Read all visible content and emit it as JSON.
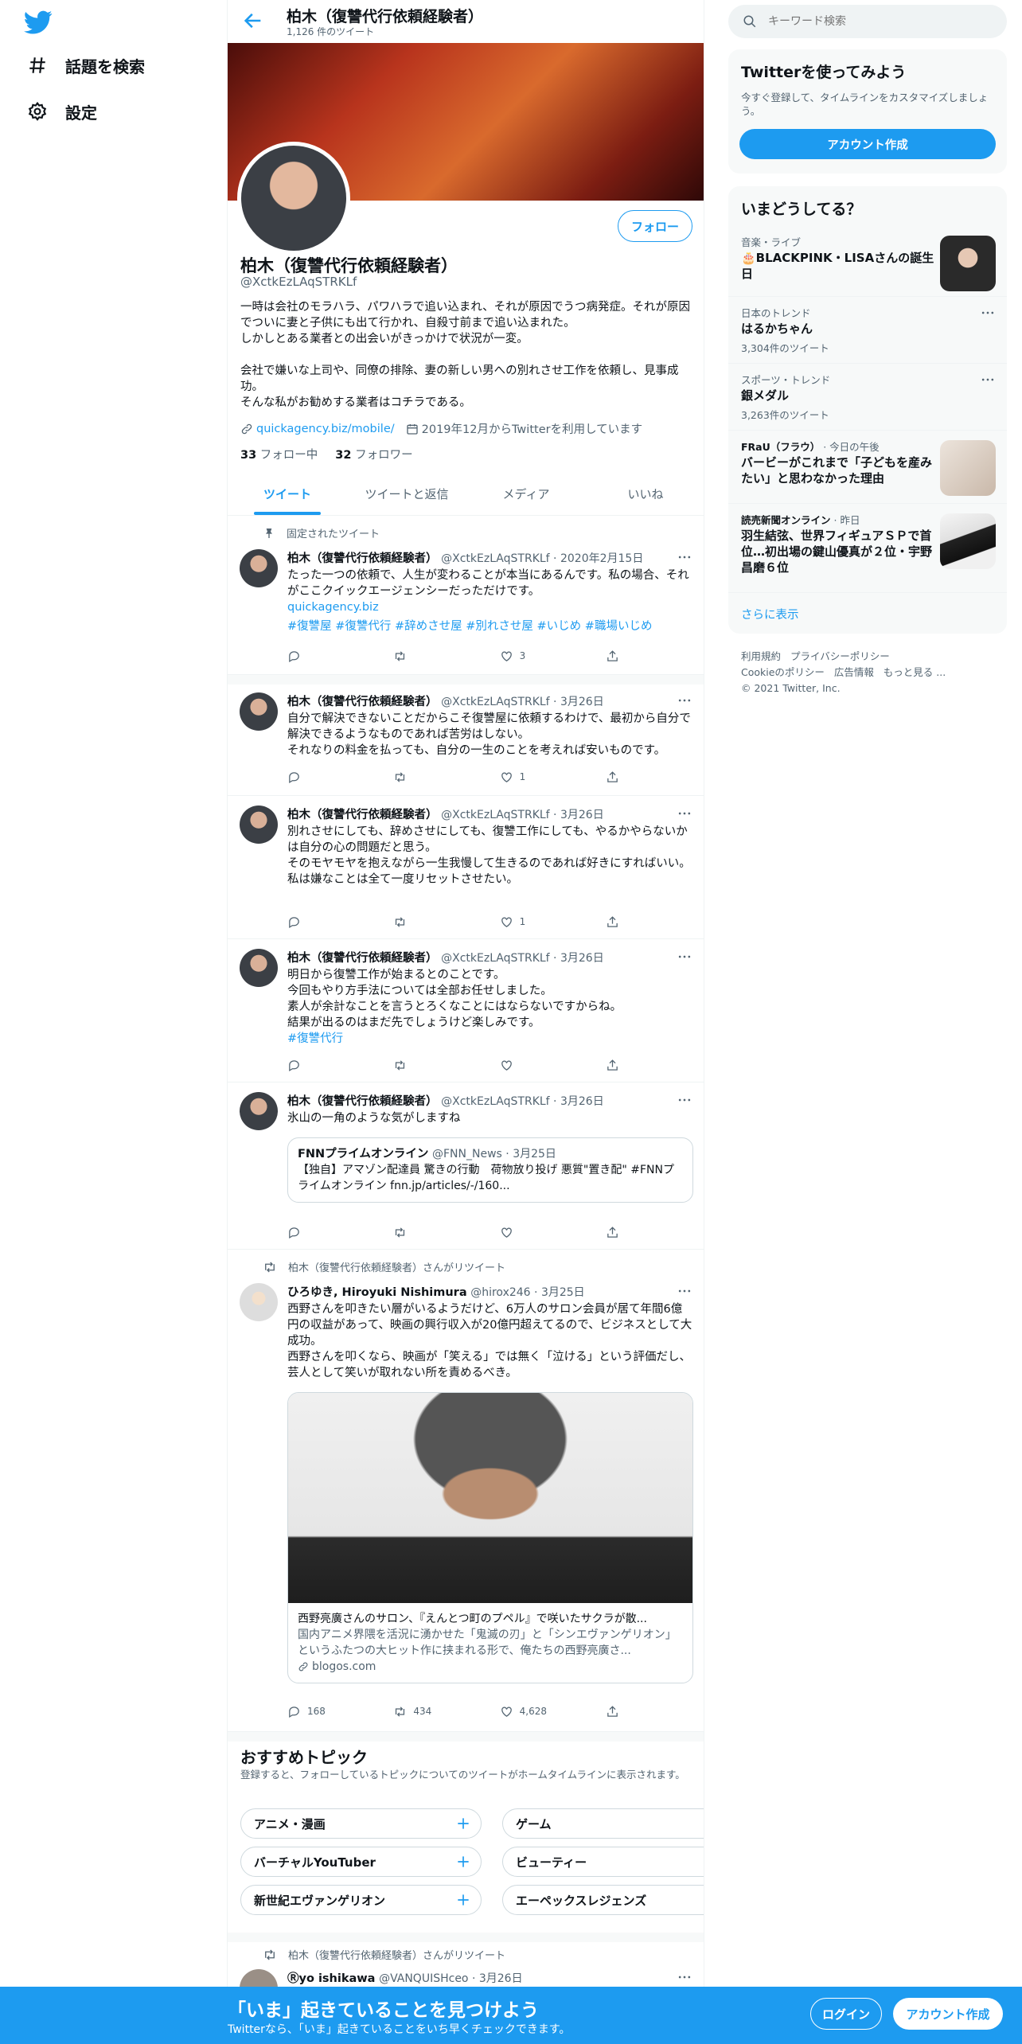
{
  "nav": {
    "explore": "話題を検索",
    "settings": "設定"
  },
  "header": {
    "title": "柏木（復讐代行依頼経験者）",
    "tweet_count": "1,126 件のツイート"
  },
  "profile": {
    "name": "柏木（復讐代行依頼経験者）",
    "handle": "@XctkEzLAqSTRKLf",
    "follow_label": "フォロー",
    "bio": [
      "一時は会社のモラハラ、パワハラで追い込まれ、それが原因でうつ病発症。それが原因でついに妻と子供にも出て行かれ、自殺寸前まで追い込まれた。",
      "しかしとある業者との出会いがきっかけで状況が一変。",
      "",
      "会社で嫌いな上司や、同僚の排除、妻の新しい男への別れさせ工作を依頼し、見事成功。",
      "そんな私がお勧めする業者はコチラである。"
    ],
    "link": "quickagency.biz/mobile/",
    "joined": "2019年12月からTwitterを利用しています",
    "following_count": "33",
    "following_label": "フォロー中",
    "followers_count": "32",
    "followers_label": "フォロワー"
  },
  "tabs": [
    "ツイート",
    "ツイートと返信",
    "メディア",
    "いいね"
  ],
  "tweets": [
    {
      "label": "固定されたツイート",
      "name": "柏木（復讐代行依頼経験者）",
      "handle": "@XctkEzLAqSTRKLf",
      "date": "2020年2月15日",
      "text": [
        "たった一つの依頼で、人生が変わることが本当にあるんです。私の場合、それがここクイックエージェンシーだっただけです。"
      ],
      "link": "quickagency.biz",
      "hashtags": "#復讐屋 #復讐代行 #辞めさせ屋 #別れさせ屋 #いじめ #職場いじめ",
      "likes": "3"
    },
    {
      "name": "柏木（復讐代行依頼経験者）",
      "handle": "@XctkEzLAqSTRKLf",
      "date": "3月26日",
      "text": [
        "自分で解決できないことだからこそ復讐屋に依頼するわけで、最初から自分で解決できるようなものであれば苦労はしない。",
        "それなりの料金を払っても、自分の一生のことを考えれば安いものです。"
      ],
      "likes": "1"
    },
    {
      "name": "柏木（復讐代行依頼経験者）",
      "handle": "@XctkEzLAqSTRKLf",
      "date": "3月26日",
      "text": [
        "別れさせにしても、辞めさせにしても、復讐工作にしても、やるかやらないかは自分の心の問題だと思う。",
        "そのモヤモヤを抱えながら一生我慢して生きるのであれば好きにすればいい。",
        "私は嫌なことは全て一度リセットさせたい。"
      ],
      "likes": "1"
    },
    {
      "name": "柏木（復讐代行依頼経験者）",
      "handle": "@XctkEzLAqSTRKLf",
      "date": "3月26日",
      "text": [
        "明日から復讐工作が始まるとのことです。",
        "今回もやり方手法については全部お任せしました。",
        "素人が余計なことを言うとろくなことにはならないですからね。",
        "結果が出るのはまだ先でしょうけど楽しみです。"
      ],
      "hashtags": "#復讐代行"
    },
    {
      "name": "柏木（復讐代行依頼経験者）",
      "handle": "@XctkEzLAqSTRKLf",
      "date": "3月26日",
      "text": [
        "氷山の一角のような気がしますね"
      ],
      "quote": {
        "name": "FNNプライムオンライン",
        "handle": "@FNN_News",
        "date": "3月25日",
        "text": "【独自】アマゾン配達員 驚きの行動　荷物放り投げ 悪質\"置き配\" #FNNプライムオンライン fnn.jp/articles/-/160..."
      }
    },
    {
      "label": "柏木（復讐代行依頼経験者）さんがリツイート",
      "name": "ひろゆき, Hiroyuki Nishimura",
      "handle": "@hirox246",
      "date": "3月25日",
      "text": [
        "西野さんを叩きたい層がいるようだけど、6万人のサロン会員が居て年間6億円の収益があって、映画の興行収入が20億円超えてるので、ビジネスとして大成功。",
        "西野さんを叩くなら、映画が「笑える」では無く「泣ける」という評価だし、芸人として笑いが取れない所を責めるべき。"
      ],
      "card": {
        "title": "西野亮廣さんのサロン、『えんとつ町のプペル』で咲いたサクラが散...",
        "desc": "国内アニメ界隈を活況に湧かせた「鬼滅の刃」と「シンエヴァンゲリオン」というふたつの大ヒット作に挟まれる形で、俺たちの西野亮廣さ...",
        "domain": "blogos.com"
      },
      "replies": "168",
      "retweets": "434",
      "likes": "4,628"
    }
  ],
  "topics": {
    "title": "おすすめトピック",
    "subtitle": "登録すると、フォローしているトピックについてのツイートがホームタイムラインに表示されます。",
    "items": [
      "アニメ・漫画",
      "ゲーム",
      "バーチャルYouTuber",
      "ビューティー",
      "新世紀エヴァンゲリオン",
      "エーペックスレジェンズ"
    ]
  },
  "last_tweet": {
    "label": "柏木（復讐代行依頼経験者）さんがリツイート",
    "name": "Ⓡyo ishikawa",
    "handle": "@VANQUISHceo",
    "date": "3月26日"
  },
  "search": {
    "placeholder": "キーワード検索"
  },
  "signup_box": {
    "title": "Twitterを使ってみよう",
    "desc": "今すぐ登録して、タイムラインをカスタマイズしましょう。",
    "button": "アカウント作成"
  },
  "trends": {
    "title": "いまどうしてる？",
    "items": [
      {
        "cat": "音楽・ライブ",
        "name": "🎂BLACKPINK・LISAさんの誕生日"
      },
      {
        "cat": "日本のトレンド",
        "name": "はるかちゃん",
        "count": "3,304件のツイート"
      },
      {
        "cat": "スポーツ・トレンド",
        "name": "銀メダル",
        "count": "3,263件のツイート"
      },
      {
        "cat": "FRaU（フラウ）",
        "meta": "今日の午後",
        "name": "バービーがこれまで「子どもを産みたい」と思わなかった理由"
      },
      {
        "cat": "読売新聞オンライン",
        "meta": "昨日",
        "name": "羽生結弦、世界フィギュアＳＰで首位…初出場の鍵山優真が２位・宇野昌磨６位"
      }
    ],
    "show_more": "さらに表示"
  },
  "footer": {
    "links": [
      "利用規約",
      "プライバシーポリシー",
      "Cookieのポリシー",
      "広告情報",
      "もっと見る ..."
    ],
    "copyright": "© 2021 Twitter, Inc."
  },
  "bottom_bar": {
    "title": "「いま」起きていることを見つけよう",
    "subtitle": "Twitterなら、「いま」起きていることをいち早くチェックできます。",
    "login": "ログイン",
    "signup": "アカウント作成"
  },
  "colors": {
    "accent": "#1d9bf0",
    "text": "#0f1419",
    "secondary": "#536471"
  }
}
